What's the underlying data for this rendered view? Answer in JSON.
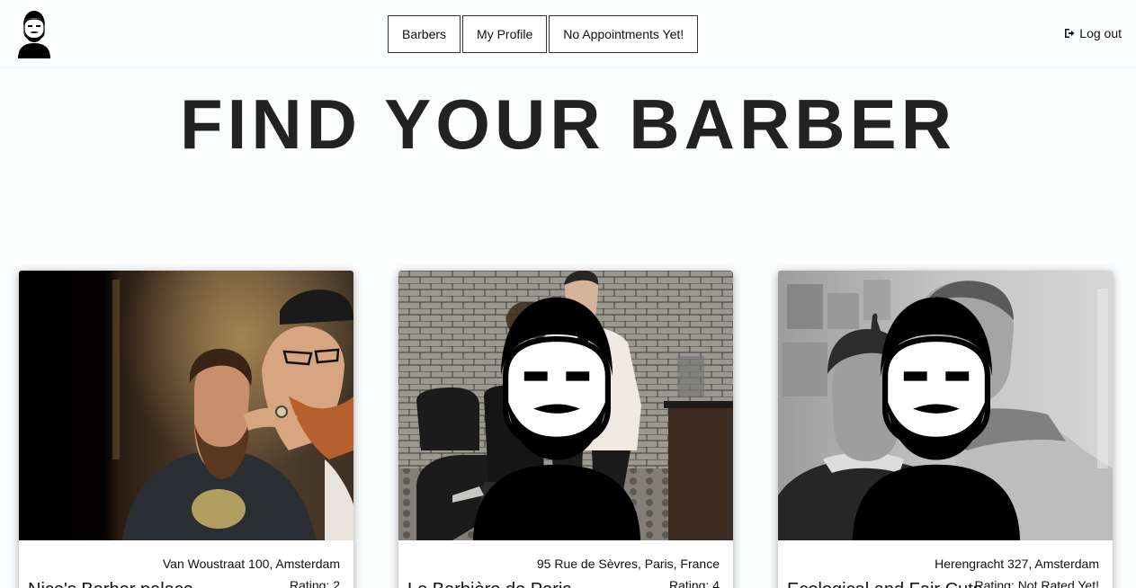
{
  "nav": {
    "logo_icon": "bearded-barber-logo-icon",
    "buttons": [
      "Barbers",
      "My Profile",
      "No Appointments Yet!"
    ],
    "logout_icon": "sign-out-icon",
    "logout_label": "Log out"
  },
  "title": "FIND YOUR BARBER",
  "cards": [
    {
      "address": "Van Woustraat 100, Amsterdam",
      "rating": "Rating: 2",
      "name": "Nice's Barber palace"
    },
    {
      "address": "95 Rue de Sèvres, Paris, France",
      "rating": "Rating: 4",
      "name": "Le Barbière de Paris"
    },
    {
      "address": "Herengracht 327, Amsterdam",
      "rating": "Rating: Not Rated Yet!",
      "name": "Ecological and Fair Cuts"
    }
  ],
  "colors": {
    "text": "#222222",
    "background": "#fcfdfe",
    "border": "#333333"
  }
}
